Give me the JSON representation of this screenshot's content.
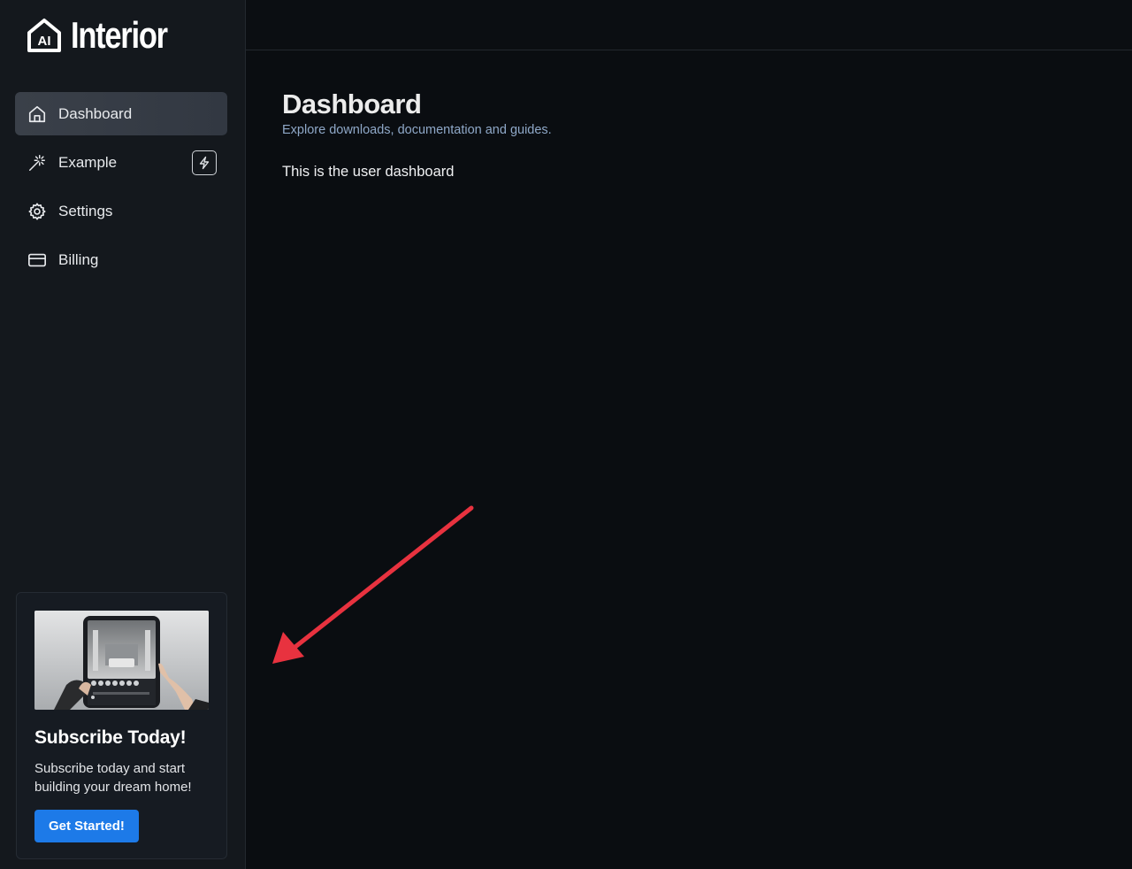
{
  "app": {
    "logo_badge": "AI",
    "logo_text": "Interior"
  },
  "sidebar": {
    "items": [
      {
        "label": "Dashboard",
        "icon": "home-icon",
        "active": true
      },
      {
        "label": "Example",
        "icon": "magic-wand-icon",
        "badge_icon": "lightning-icon"
      },
      {
        "label": "Settings",
        "icon": "gear-icon"
      },
      {
        "label": "Billing",
        "icon": "credit-card-icon"
      }
    ]
  },
  "promo": {
    "image_icon": "tablet-interior-image",
    "title": "Subscribe Today!",
    "text": "Subscribe today and start building your dream home!",
    "button_label": "Get Started!"
  },
  "main": {
    "title": "Dashboard",
    "subtitle": "Explore downloads, documentation and guides.",
    "body": "This is the user dashboard"
  },
  "colors": {
    "accent": "#1d7ae8",
    "annotation_arrow": "#e8323f",
    "subtitle": "#8fa8c8"
  }
}
